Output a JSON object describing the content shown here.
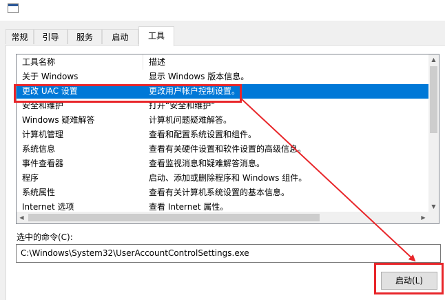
{
  "dialog": {
    "tabs": [
      {
        "label": "常规"
      },
      {
        "label": "引导"
      },
      {
        "label": "服务"
      },
      {
        "label": "启动"
      },
      {
        "label": "工具"
      }
    ],
    "active_tab": "工具"
  },
  "tools": {
    "columns": [
      "工具名称",
      "描述"
    ],
    "rows": [
      {
        "name": "关于 Windows",
        "desc": "显示 Windows 版本信息。"
      },
      {
        "name": "更改 UAC 设置",
        "desc": "更改用户帐户控制设置。",
        "selected": true
      },
      {
        "name": "安全和维护",
        "desc": "打开“安全和维护”"
      },
      {
        "name": "Windows 疑难解答",
        "desc": "计算机问题疑难解答。"
      },
      {
        "name": "计算机管理",
        "desc": "查看和配置系统设置和组件。"
      },
      {
        "name": "系统信息",
        "desc": "查看有关硬件设置和软件设置的高级信息。"
      },
      {
        "name": "事件查看器",
        "desc": "查看监视消息和疑难解答消息。"
      },
      {
        "name": "程序",
        "desc": "启动、添加或删除程序和 Windows 组件。"
      },
      {
        "name": "系统属性",
        "desc": "查看有关计算机系统设置的基本信息。"
      },
      {
        "name": "Internet 选项",
        "desc": "查看 Internet 属性。"
      }
    ]
  },
  "command": {
    "label": "选中的命令(C):",
    "value": "C:\\Windows\\System32\\UserAccountControlSettings.exe"
  },
  "buttons": {
    "launch": "启动(L)"
  },
  "colors": {
    "selection": "#0078d7",
    "annotation_red": "#e8262a"
  }
}
